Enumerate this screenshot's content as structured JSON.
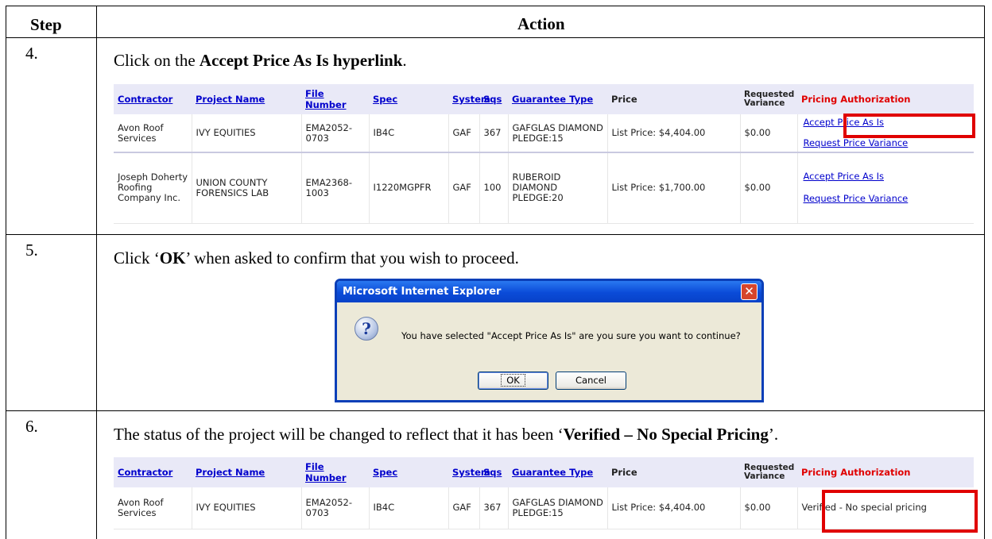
{
  "header": {
    "step": "Step",
    "action": "Action"
  },
  "columns": [
    "Contractor",
    "Project Name",
    "File Number",
    "Spec",
    "System",
    "Sqs",
    "Guarantee Type",
    "Price",
    "Requested Variance",
    "Pricing Authorization"
  ],
  "step4": {
    "num": "4.",
    "instr_pre": "Click on the ",
    "instr_bold": "Accept Price As Is hyperlink",
    "instr_post": ".",
    "rows": [
      {
        "contractor": "Avon Roof Services",
        "project": "IVY EQUITIES",
        "file": "EMA2052-0703",
        "spec": "IB4C",
        "system": "GAF",
        "sqs": "367",
        "guarantee": "GAFGLAS DIAMOND PLEDGE:15",
        "price": "List Price: $4,404.00",
        "variance": "$0.00",
        "link1": "Accept Price As Is",
        "link2": "Request Price Variance"
      },
      {
        "contractor": "Joseph Doherty Roofing Company Inc.",
        "project": "UNION COUNTY FORENSICS LAB",
        "file": "EMA2368-1003",
        "spec": "I1220MGPFR",
        "system": "GAF",
        "sqs": "100",
        "guarantee": "RUBEROID DIAMOND PLEDGE:20",
        "price": "List Price: $1,700.00",
        "variance": "$0.00",
        "link1": "Accept Price As Is",
        "link2": "Request Price Variance"
      }
    ]
  },
  "step5": {
    "num": "5.",
    "instr_pre": "Click ‘",
    "instr_bold": "OK",
    "instr_post": "’ when asked to confirm that you wish to proceed.",
    "dialog": {
      "title": "Microsoft Internet Explorer",
      "close": "✕",
      "icon": "?",
      "message": "You have selected \"Accept Price As Is\" are you sure you want to continue?",
      "ok": "OK",
      "cancel": "Cancel"
    }
  },
  "step6": {
    "num": "6.",
    "instr_pre": "The status of the project will be changed to reflect that it has been ‘",
    "instr_bold": "Verified – No Special Pricing",
    "instr_post": "’.",
    "rows": [
      {
        "contractor": "Avon Roof Services",
        "project": "IVY EQUITIES",
        "file": "EMA2052-0703",
        "spec": "IB4C",
        "system": "GAF",
        "sqs": "367",
        "guarantee": "GAFGLAS DIAMOND PLEDGE:15",
        "price": "List Price: $4,404.00",
        "variance": "$0.00",
        "status": "Verified - No special pricing"
      }
    ]
  },
  "colors": {
    "link": "#0000cc",
    "highlight": "#e00000",
    "header_bg": "#e9e9f7",
    "dialog_border": "#0a3fb8"
  }
}
